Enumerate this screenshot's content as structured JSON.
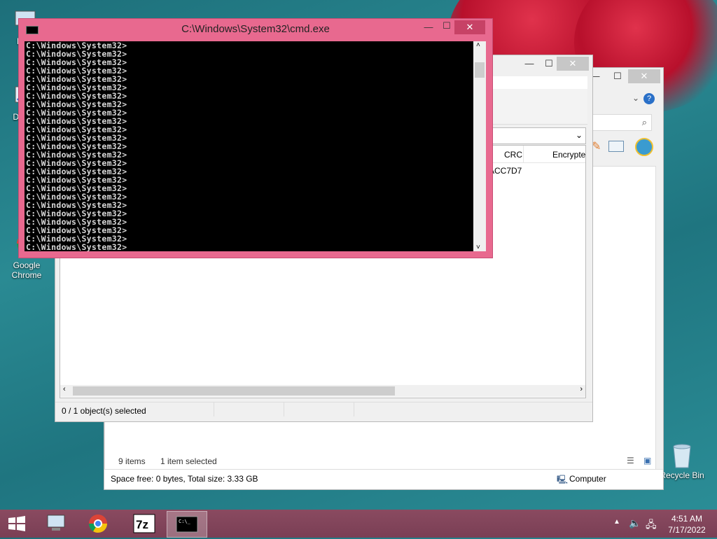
{
  "desktop": {
    "icons": [
      {
        "label": "My C",
        "icon": "computer-icon"
      },
      {
        "label": "Data",
        "icon": "shortcut-icon"
      },
      {
        "label": "Google\nChrome",
        "icon": "chrome-icon"
      },
      {
        "label": "Recycle Bin",
        "icon": "recycle-bin-icon"
      }
    ]
  },
  "cmd": {
    "title": "C:\\Windows\\System32\\cmd.exe",
    "prompt": "C:\\Windows\\System32>",
    "line_count": 25
  },
  "sevenzip": {
    "columns": [
      "CRC",
      "Encrypte"
    ],
    "row_crc": "ACC7D7",
    "status": "0 / 1 object(s) selected"
  },
  "explorer": {
    "items_count": "9 items",
    "selected": "1 item selected",
    "space_info": "Space free: 0 bytes, Total size: 3.33 GB",
    "location": "Computer"
  },
  "taskbar": {
    "time": "4:51 AM",
    "date": "7/17/2022",
    "apps": [
      "file-explorer-icon",
      "chrome-icon",
      "7zip-icon",
      "cmd-icon"
    ]
  },
  "colors": {
    "cmd_frame": "#e8698f",
    "taskbar": "#7a3f55",
    "desktop": "#1f7580"
  }
}
